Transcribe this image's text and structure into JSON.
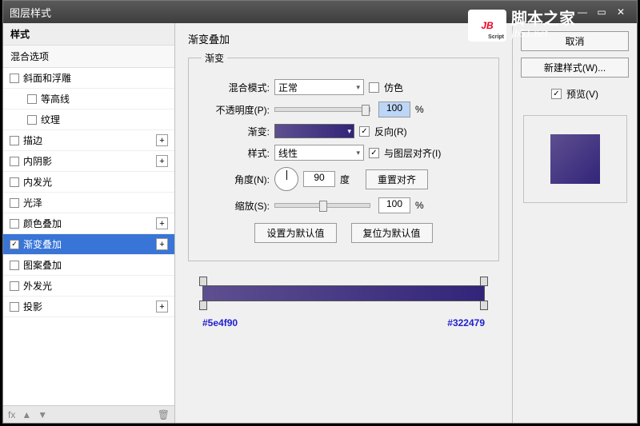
{
  "window": {
    "title": "图层样式"
  },
  "watermark": {
    "logo": "JB",
    "logo_sub": "Script",
    "line1": "脚本之家",
    "line2": "jb51.net"
  },
  "sidebar": {
    "header1": "样式",
    "header2": "混合选项",
    "items": [
      {
        "label": "斜面和浮雕",
        "checked": false,
        "plus": false,
        "indent": false
      },
      {
        "label": "等高线",
        "checked": false,
        "plus": false,
        "indent": true
      },
      {
        "label": "纹理",
        "checked": false,
        "plus": false,
        "indent": true
      },
      {
        "label": "描边",
        "checked": false,
        "plus": true,
        "indent": false
      },
      {
        "label": "内阴影",
        "checked": false,
        "plus": true,
        "indent": false
      },
      {
        "label": "内发光",
        "checked": false,
        "plus": false,
        "indent": false
      },
      {
        "label": "光泽",
        "checked": false,
        "plus": false,
        "indent": false
      },
      {
        "label": "颜色叠加",
        "checked": false,
        "plus": true,
        "indent": false
      },
      {
        "label": "渐变叠加",
        "checked": true,
        "plus": true,
        "indent": false,
        "selected": true
      },
      {
        "label": "图案叠加",
        "checked": false,
        "plus": false,
        "indent": false
      },
      {
        "label": "外发光",
        "checked": false,
        "plus": false,
        "indent": false
      },
      {
        "label": "投影",
        "checked": false,
        "plus": true,
        "indent": false
      }
    ],
    "footer": {
      "fx": "fx",
      "trash_icon": "🗑"
    }
  },
  "panel": {
    "title": "渐变叠加",
    "fieldset_legend": "渐变",
    "labels": {
      "blend_mode": "混合模式:",
      "opacity": "不透明度(P):",
      "gradient": "渐变:",
      "style": "样式:",
      "angle": "角度(N):",
      "scale": "缩放(S):"
    },
    "values": {
      "blend_mode": "正常",
      "opacity": "100",
      "opacity_unit": "%",
      "style": "线性",
      "angle": "90",
      "angle_unit": "度",
      "scale": "100",
      "scale_unit": "%"
    },
    "checkboxes": {
      "dither": "仿色",
      "reverse": "反向(R)",
      "align": "与图层对齐(I)",
      "dither_checked": false,
      "reverse_checked": true,
      "align_checked": true
    },
    "buttons": {
      "reset_align": "重置对齐",
      "set_default": "设置为默认值",
      "reset_default": "复位为默认值"
    },
    "gradient": {
      "left_hex": "#5e4f90",
      "right_hex": "#322479"
    }
  },
  "right": {
    "cancel": "取消",
    "new_style": "新建样式(W)...",
    "preview_label": "预览(V)",
    "preview_checked": true
  }
}
